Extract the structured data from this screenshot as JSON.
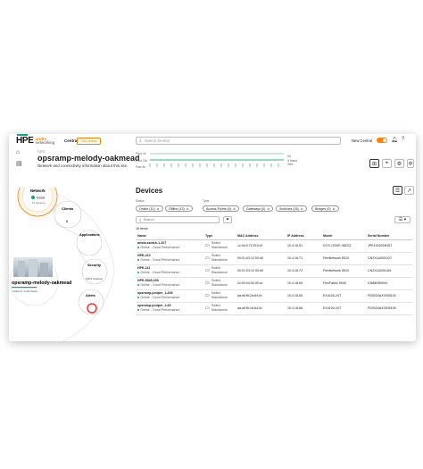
{
  "header": {
    "logo_hpe": "HPE",
    "logo_aruba": "aruba",
    "logo_networking": "networking",
    "product": "Central",
    "badge": "Trial Version",
    "search_placeholder": "Search Central",
    "new_central_label": "New Central",
    "new_central_on": true
  },
  "site": {
    "crumb": "SITE",
    "name": "opsramp-melody-oakmead",
    "description": "Network and connectivity information about this site."
  },
  "timeline": {
    "rows": [
      "Prior 4h",
      "Prior 24h",
      "Past 8h"
    ],
    "end_labels": [
      "3h",
      "9 hours",
      "30m"
    ],
    "tick_labels": [
      "4h",
      "",
      "",
      "",
      "",
      "",
      "",
      "",
      "",
      "",
      "",
      "",
      "",
      "",
      "",
      "Now"
    ]
  },
  "radial": {
    "network": {
      "title": "Network",
      "status": "Good",
      "sub": "16 devices"
    },
    "clients": {
      "title": "Clients",
      "value": "6"
    },
    "applications": {
      "title": "Applications",
      "value": ""
    },
    "security": {
      "title": "Security",
      "sub": "WIDS Disabled"
    },
    "alerts": {
      "title": "Alerts"
    },
    "site_card": {
      "name": "opsramp-melody-oakmead",
      "location": "California, United States"
    }
  },
  "devices": {
    "title": "Devices",
    "status_label": "Status",
    "type_label": "Type",
    "status_chips": [
      "Online (11)",
      "Offline (13)"
    ],
    "type_chips": [
      "Access Points (0)",
      "Gateways (0)",
      "Switches (16)",
      "Bridges (0)"
    ],
    "search_placeholder": "Search",
    "count": "16 items",
    "columns": [
      "Name",
      "Type",
      "MAC Address",
      "IP Address",
      "Model",
      "Serial Number"
    ],
    "rows": [
      {
        "name": "arista-switch-1-207",
        "status": "Online - Good Performance",
        "type1": "Switch",
        "type2": "Standalone",
        "mac": "1c:4d:0:72:f3:0:ef",
        "ip": "10.4.18.51",
        "model": "CCS-720XP-48ZC2",
        "serial": "JPE19150260DT"
      },
      {
        "name": "HPE-210",
        "status": "Online - Good Performance",
        "type1": "Switch",
        "type2": "Standalone",
        "mac": "00:01:03:12:00:d0",
        "ip": "10.4.18.71",
        "model": "FlexNetwork 5510",
        "serial": "CN2XLA0001C0"
      },
      {
        "name": "HPE-211",
        "status": "Online - Good Performance",
        "type1": "Switch",
        "type2": "Standalone",
        "mac": "00:01:03:12:00:d0",
        "ip": "10.4.18.72",
        "model": "FlexNetwork 5510",
        "serial": "CN2XLA0001A9"
      },
      {
        "name": "HPE-5945-209",
        "status": "Online - Good Performance",
        "type1": "Switch",
        "type2": "Standalone",
        "mac": "2c:00:04:30:40:cc",
        "ip": "10.4.18.69",
        "model": "FlexFabric 5945",
        "serial": "CN88KB0004"
      },
      {
        "name": "opsramp-juniper_1-205",
        "status": "Online - Good Performance",
        "type1": "Switch",
        "type2": "Standalone",
        "mac": "aa:a0:f6:2a:64:0c",
        "ip": "10.4.18.65",
        "model": "EX4100-24T",
        "serial": "FD0024AX0005100"
      },
      {
        "name": "opsramp-juniper_2-65",
        "status": "Online - Good Performance",
        "type1": "Switch",
        "type2": "Standalone",
        "mac": "aa:a0:f6:2a:64:0c",
        "ip": "10.4.18.66",
        "model": "EX4100-24T",
        "serial": "FD0024AX0005105"
      }
    ]
  },
  "colors": {
    "accent": "#ff8300",
    "good": "#01a982",
    "alert": "#e5403b"
  }
}
